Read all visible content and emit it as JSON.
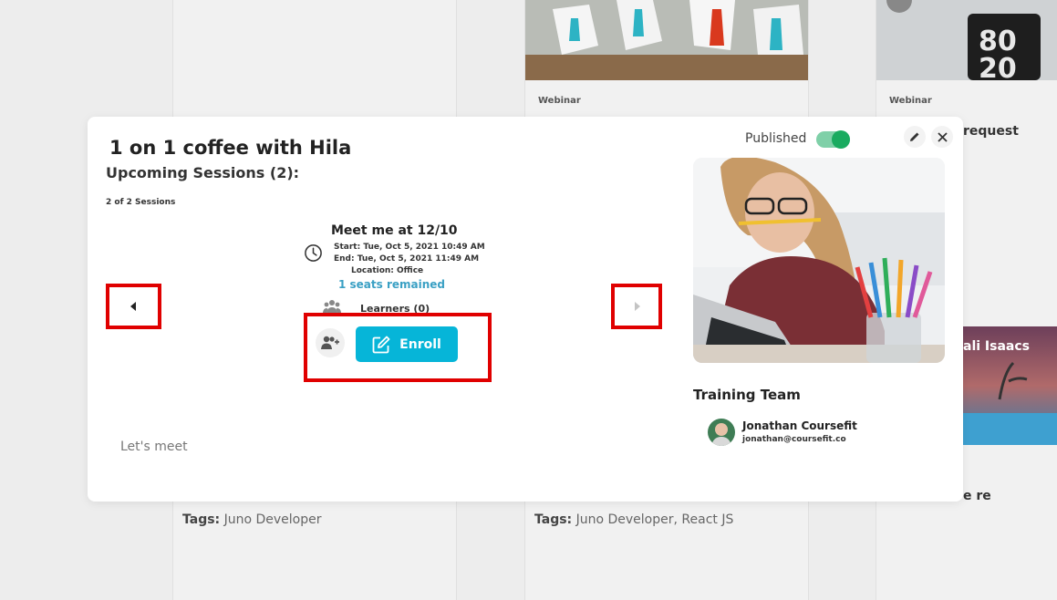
{
  "background": {
    "cards": [
      {
        "type": "",
        "tags_label": "Tags:",
        "tags_value": " Juno Developer"
      },
      {
        "type": "Webinar",
        "tags_label": "Tags:",
        "tags_value": " Juno Developer, React JS"
      },
      {
        "type": "Webinar",
        "side_title": "request",
        "side_name": "ali Isaacs",
        "side_bottom": "e re"
      }
    ]
  },
  "modal": {
    "title": "1 on 1 coffee with Hila",
    "subtitle": "Upcoming Sessions (2):",
    "session_count": "2 of 2 Sessions",
    "session": {
      "title": "Meet me at 12/10",
      "start": "Start: Tue, Oct 5, 2021 10:49 AM",
      "end": "End: Tue, Oct 5, 2021 11:49 AM",
      "location": "Location: Office",
      "seats": "1 seats remained",
      "learners": "Learners (0)"
    },
    "enroll_label": "Enroll",
    "description": "Let's meet",
    "published_label": "Published",
    "published_on": true,
    "team_title": "Training Team",
    "team": [
      {
        "name": "Jonathan Coursefit",
        "email": "jonathan@coursefit.co"
      }
    ]
  },
  "icons": {
    "prev": "caret-left-icon",
    "next": "caret-right-icon",
    "edit": "pencil-icon",
    "close": "close-icon",
    "clock": "clock-icon",
    "learners": "users-icon",
    "add_user": "user-plus-icon",
    "enroll": "edit-square-icon"
  },
  "colors": {
    "accent": "#06b5d8",
    "seats": "#3aa0c4",
    "highlight": "#e00000",
    "toggle_on": "#1aab60"
  }
}
